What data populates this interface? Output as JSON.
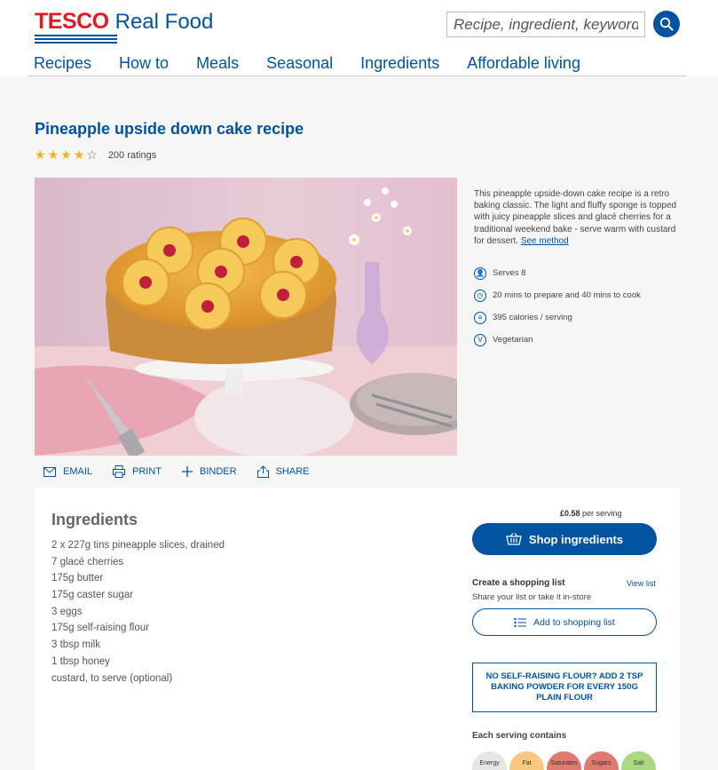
{
  "brand": {
    "tesco": "TESCO",
    "realfood": "Real Food"
  },
  "search": {
    "placeholder": "Recipe, ingredient, keyword"
  },
  "nav": [
    "Recipes",
    "How to",
    "Meals",
    "Seasonal",
    "Ingredients",
    "Affordable living"
  ],
  "recipe": {
    "title": "Pineapple upside down cake recipe",
    "rating_value": 4,
    "rating_max": 5,
    "ratings_label": "200 ratings",
    "description": "This pineapple upside-down cake recipe is a retro baking classic. The light and fluffy sponge is topped with juicy pineapple slices and glacé cherries for a traditional weekend bake - serve warm with custard for dessert.",
    "see_method": "See method",
    "facts": [
      "Serves 8",
      "20 mins to prepare and 40 mins to cook",
      "395 calories / serving",
      "Vegetarian"
    ]
  },
  "actions": [
    "EMAIL",
    "PRINT",
    "BINDER",
    "SHARE"
  ],
  "ingredients": {
    "title": "Ingredients",
    "items": [
      "2 x 227g tins pineapple slices, drained",
      "7 glacé cherries",
      "175g butter",
      "175g caster sugar",
      "3 eggs",
      "175g self-raising flour",
      "3 tbsp milk",
      "1 tbsp honey",
      "custard, to serve (optional)"
    ]
  },
  "shop": {
    "price": "£0.58",
    "price_suffix": "per serving",
    "button": "Shop ingredients",
    "list_title": "Create a shopping list",
    "list_sub": "Share your list or take it in-store",
    "view_list": "View list",
    "add_list": "Add to shopping list"
  },
  "tip": "NO SELF-RAISING FLOUR? ADD 2 TSP BAKING POWDER FOR EVERY 150G PLAIN FLOUR",
  "nutrition": {
    "title": "Each serving contains",
    "items": [
      {
        "label": "Energy",
        "color": "#e6e6e6"
      },
      {
        "label": "Fat",
        "color": "#f7c97f"
      },
      {
        "label": "Saturates",
        "color": "#e07a6e"
      },
      {
        "label": "Sugars",
        "color": "#e07a6e"
      },
      {
        "label": "Salt",
        "color": "#a9d87f"
      }
    ]
  },
  "colors": {
    "brand_blue": "#00539f",
    "tesco_red": "#e11b22",
    "star": "#f2b21b"
  }
}
